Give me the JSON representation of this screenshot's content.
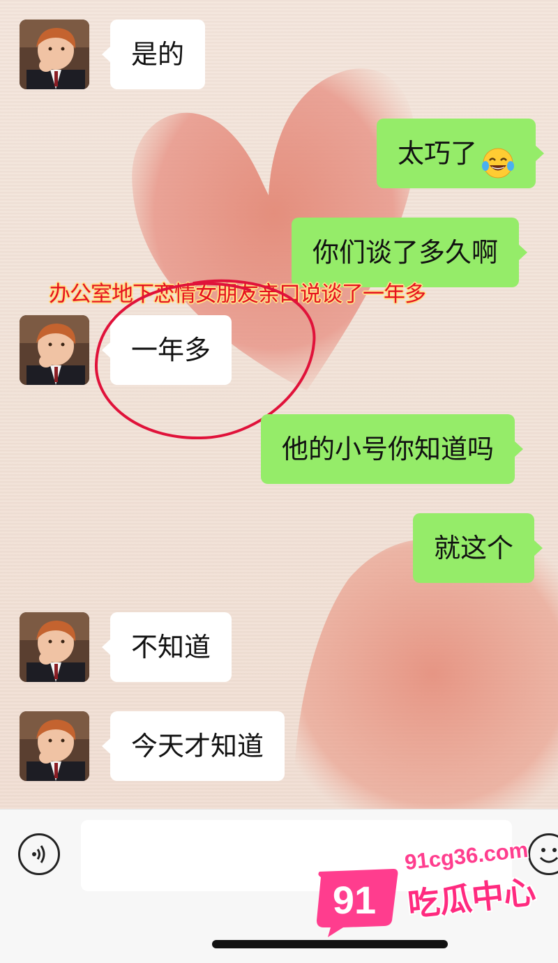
{
  "messages": [
    {
      "side": "left",
      "text": "是的"
    },
    {
      "side": "right",
      "text": "太巧了",
      "emoji": "tears-of-joy-emoji"
    },
    {
      "side": "right",
      "text": "你们谈了多久啊"
    },
    {
      "side": "left",
      "text": "一年多"
    },
    {
      "side": "right",
      "text": "他的小号你知道吗"
    },
    {
      "side": "right",
      "text": "就这个"
    },
    {
      "side": "left",
      "text": "不知道"
    },
    {
      "side": "left",
      "text": "今天才知道"
    }
  ],
  "annotation": {
    "caption": "办公室地下恋情女朋友亲口说谈了一年多",
    "caption_color": "#e6121e",
    "circle_color": "#e0123a"
  },
  "input_bar": {
    "voice_icon": "voice-icon",
    "emoji_icon": "emoji-icon",
    "text_value": ""
  },
  "watermark": {
    "badge": "91",
    "domain": "91cg36.com",
    "name": "吃瓜中心",
    "color": "#ff2a7f"
  },
  "colors": {
    "sent_bubble": "#95ec69",
    "received_bubble": "#ffffff",
    "background": "#f2e3d8",
    "heart": "#e8907e"
  }
}
